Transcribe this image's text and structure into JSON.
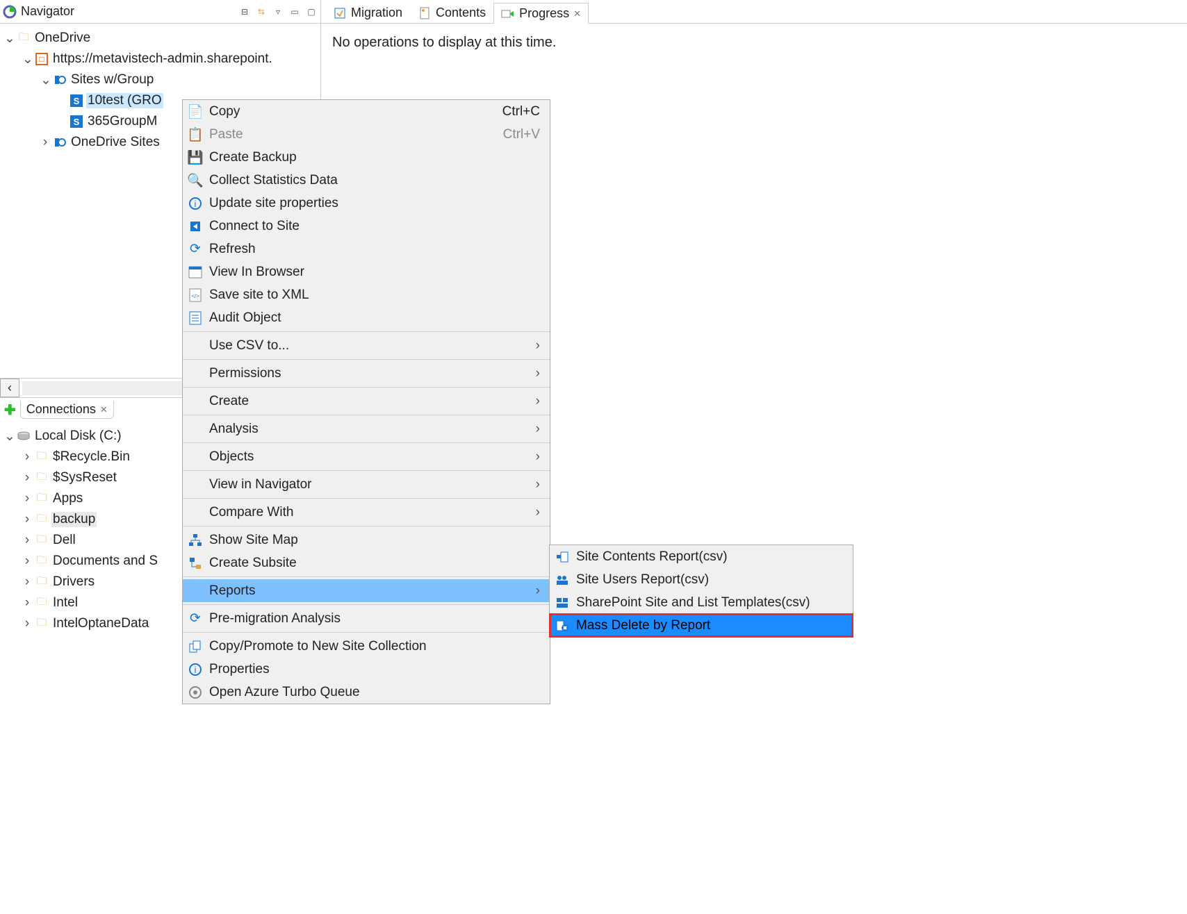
{
  "navigator": {
    "title": "Navigator",
    "tree": {
      "root": "OneDrive",
      "tenant": "https://metavistech-admin.sharepoint.",
      "sites_group": "Sites w/Group",
      "item_a": "10test (GRO",
      "item_b": "365GroupM",
      "onedrive_sites": "OneDrive Sites"
    }
  },
  "connections": {
    "title": "Connections",
    "disk": "Local Disk (C:)",
    "items": [
      "$Recycle.Bin",
      "$SysReset",
      "Apps",
      "backup",
      "Dell",
      "Documents and S",
      "Drivers",
      "Intel",
      "IntelOptaneData"
    ]
  },
  "tabs": {
    "migration": "Migration",
    "contents": "Contents",
    "progress": "Progress"
  },
  "main": {
    "empty": "No operations to display at this time."
  },
  "ctx": {
    "copy": "Copy",
    "copy_sc": "Ctrl+C",
    "paste": "Paste",
    "paste_sc": "Ctrl+V",
    "create_backup": "Create Backup",
    "collect_stats": "Collect Statistics Data",
    "update_props": "Update site properties",
    "connect": "Connect to Site",
    "refresh": "Refresh",
    "view_browser": "View In Browser",
    "save_xml": "Save site to XML",
    "audit": "Audit Object",
    "use_csv": "Use CSV to...",
    "permissions": "Permissions",
    "create": "Create",
    "analysis": "Analysis",
    "objects": "Objects",
    "view_nav": "View in Navigator",
    "compare": "Compare With",
    "site_map": "Show Site Map",
    "subsite": "Create Subsite",
    "reports": "Reports",
    "premig": "Pre-migration Analysis",
    "copy_promote": "Copy/Promote to New Site Collection",
    "properties": "Properties",
    "azure_turbo": "Open Azure Turbo Queue"
  },
  "sub": {
    "site_contents": "Site Contents Report(csv)",
    "site_users": "Site Users Report(csv)",
    "templates": "SharePoint Site and List Templates(csv)",
    "mass_delete": "Mass Delete by Report"
  }
}
